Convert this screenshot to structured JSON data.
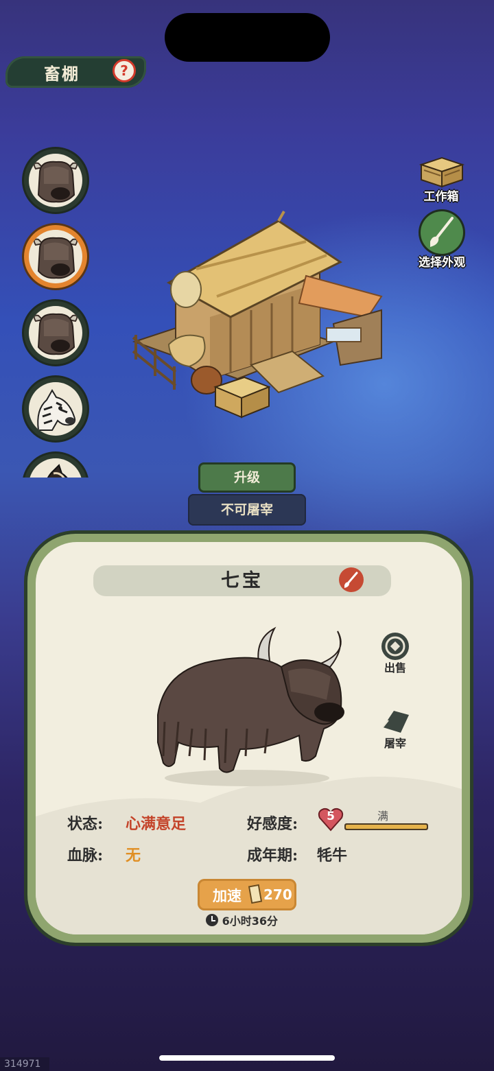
{
  "header": {
    "title": "畜棚",
    "help_icon": "question-icon"
  },
  "animals": [
    {
      "kind": "yak",
      "selected": false
    },
    {
      "kind": "yak",
      "selected": true
    },
    {
      "kind": "yak",
      "selected": false
    },
    {
      "kind": "zebra",
      "selected": false
    },
    {
      "kind": "horse",
      "selected": false
    }
  ],
  "side_buttons": {
    "workbox_label": "工作箱",
    "appearance_label": "选择外观"
  },
  "barn_actions": {
    "upgrade_label": "升级",
    "no_slaughter_label": "不可屠宰"
  },
  "card": {
    "name": "七宝",
    "sell_label": "出售",
    "slaughter_label": "屠宰",
    "status_label": "状态:",
    "status_value": "心满意足",
    "bloodline_label": "血脉:",
    "bloodline_value": "无",
    "affection_label": "好感度:",
    "affection_level": "5",
    "affection_bar_label": "满",
    "affection_fill": 1.0,
    "stage_label": "成年期:",
    "stage_value": "牦牛",
    "speedup_label": "加速",
    "speedup_cost": "270",
    "timer": "6小时36分"
  },
  "footer": {
    "id_tag": "314971"
  },
  "colors": {
    "accent_green": "#4d7a4a",
    "status_red": "#c4442a",
    "bloodline_orange": "#e08f24",
    "speed_button": "#e6a24a"
  }
}
